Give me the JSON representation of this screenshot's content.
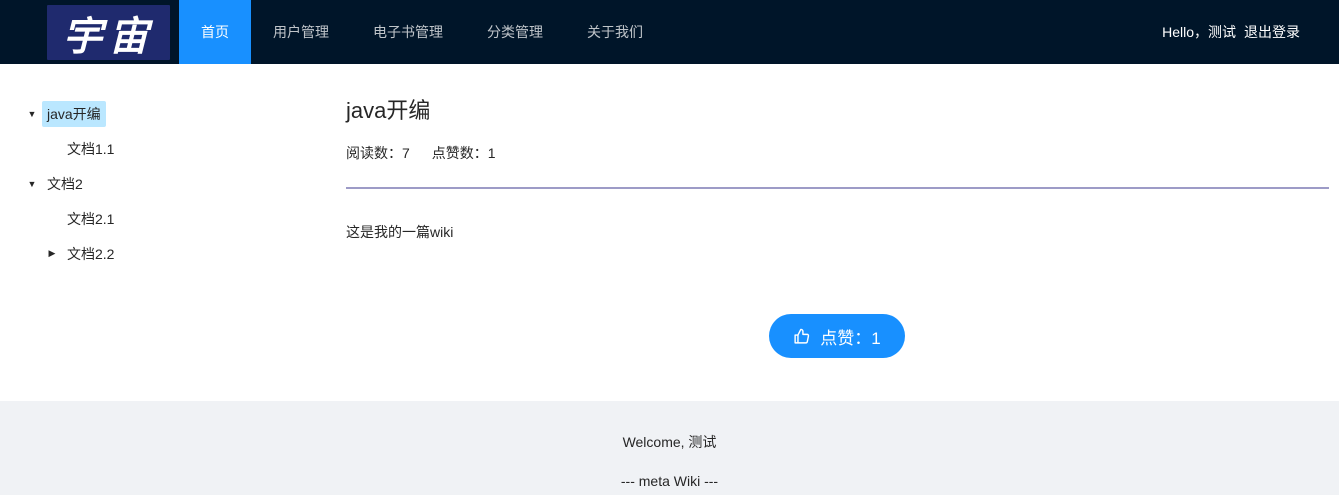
{
  "header": {
    "logo_text": "宇宙",
    "menu": [
      {
        "label": "首页",
        "active": true
      },
      {
        "label": "用户管理",
        "active": false
      },
      {
        "label": "电子书管理",
        "active": false
      },
      {
        "label": "分类管理",
        "active": false
      },
      {
        "label": "关于我们",
        "active": false
      }
    ],
    "greeting": "Hello，测试",
    "logout": "退出登录"
  },
  "tree": {
    "nodes": [
      {
        "label": "java开编",
        "level": 0,
        "switcher": "expanded",
        "selected": true
      },
      {
        "label": "文档1.1",
        "level": 1,
        "switcher": "none",
        "selected": false
      },
      {
        "label": "文档2",
        "level": 0,
        "switcher": "expanded",
        "selected": false
      },
      {
        "label": "文档2.1",
        "level": 1,
        "switcher": "none",
        "selected": false
      },
      {
        "label": "文档2.2",
        "level": 1,
        "switcher": "collapsed",
        "selected": false
      }
    ]
  },
  "doc": {
    "title": "java开编",
    "view_count": "阅读数：7",
    "vote_count": "点赞数：1",
    "body": "这是我的一篇wiki"
  },
  "vote_button": {
    "label": "点赞：1",
    "icon": "like-icon"
  },
  "footer": {
    "welcome": "Welcome, 测试",
    "brand": "--- meta Wiki ---"
  },
  "colors": {
    "header_bg": "#001529",
    "accent": "#1890ff",
    "selected_bg": "#bae7ff",
    "divider": "#9d9bc7",
    "footer_bg": "#f0f2f5"
  }
}
